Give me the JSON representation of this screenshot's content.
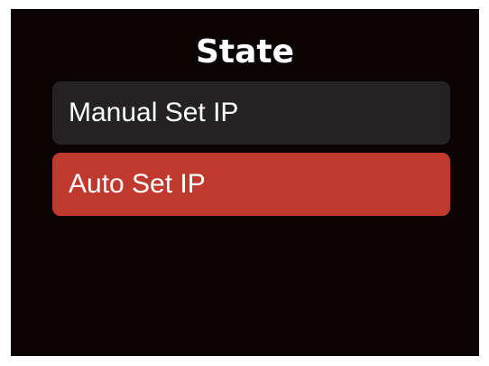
{
  "screen": {
    "title": "State",
    "menu": [
      {
        "label": "Manual Set IP",
        "selected": false
      },
      {
        "label": "Auto Set IP",
        "selected": true
      }
    ]
  },
  "colors": {
    "background": "#0a0404",
    "item_normal": "#252223",
    "item_selected": "#c0392e",
    "text": "#ffffff"
  }
}
